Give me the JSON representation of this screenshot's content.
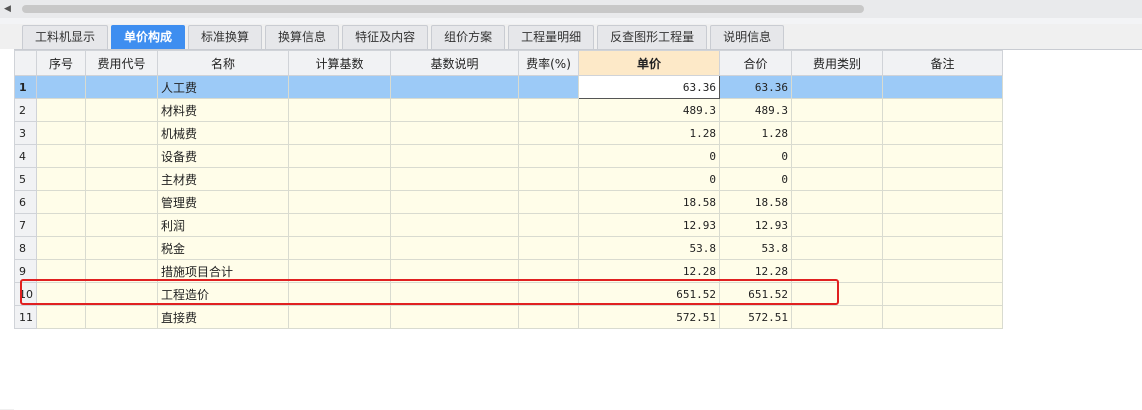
{
  "tabs": [
    "工料机显示",
    "单价构成",
    "标准换算",
    "换算信息",
    "特征及内容",
    "组价方案",
    "工程量明细",
    "反查图形工程量",
    "说明信息"
  ],
  "active_tab": "单价构成",
  "columns": [
    "",
    "序号",
    "费用代号",
    "名称",
    "计算基数",
    "基数说明",
    "费率(%)",
    "单价",
    "合价",
    "费用类别",
    "备注"
  ],
  "rows": [
    {
      "no": "1",
      "seq": "",
      "code": "",
      "name": "人工费",
      "base": "",
      "base_desc": "",
      "rate": "",
      "unit_price": "63.36",
      "total": "63.36",
      "category": "",
      "remark": ""
    },
    {
      "no": "2",
      "seq": "",
      "code": "",
      "name": "材料费",
      "base": "",
      "base_desc": "",
      "rate": "",
      "unit_price": "489.3",
      "total": "489.3",
      "category": "",
      "remark": ""
    },
    {
      "no": "3",
      "seq": "",
      "code": "",
      "name": "机械费",
      "base": "",
      "base_desc": "",
      "rate": "",
      "unit_price": "1.28",
      "total": "1.28",
      "category": "",
      "remark": ""
    },
    {
      "no": "4",
      "seq": "",
      "code": "",
      "name": "设备费",
      "base": "",
      "base_desc": "",
      "rate": "",
      "unit_price": "0",
      "total": "0",
      "category": "",
      "remark": ""
    },
    {
      "no": "5",
      "seq": "",
      "code": "",
      "name": "主材费",
      "base": "",
      "base_desc": "",
      "rate": "",
      "unit_price": "0",
      "total": "0",
      "category": "",
      "remark": ""
    },
    {
      "no": "6",
      "seq": "",
      "code": "",
      "name": "管理费",
      "base": "",
      "base_desc": "",
      "rate": "",
      "unit_price": "18.58",
      "total": "18.58",
      "category": "",
      "remark": ""
    },
    {
      "no": "7",
      "seq": "",
      "code": "",
      "name": "利润",
      "base": "",
      "base_desc": "",
      "rate": "",
      "unit_price": "12.93",
      "total": "12.93",
      "category": "",
      "remark": ""
    },
    {
      "no": "8",
      "seq": "",
      "code": "",
      "name": "税金",
      "base": "",
      "base_desc": "",
      "rate": "",
      "unit_price": "53.8",
      "total": "53.8",
      "category": "",
      "remark": ""
    },
    {
      "no": "9",
      "seq": "",
      "code": "",
      "name": "措施项目合计",
      "base": "",
      "base_desc": "",
      "rate": "",
      "unit_price": "12.28",
      "total": "12.28",
      "category": "",
      "remark": ""
    },
    {
      "no": "10",
      "seq": "",
      "code": "",
      "name": "工程造价",
      "base": "",
      "base_desc": "",
      "rate": "",
      "unit_price": "651.52",
      "total": "651.52",
      "category": "",
      "remark": ""
    },
    {
      "no": "11",
      "seq": "",
      "code": "",
      "name": "直接费",
      "base": "",
      "base_desc": "",
      "rate": "",
      "unit_price": "572.51",
      "total": "572.51",
      "category": "",
      "remark": ""
    }
  ],
  "selected_row": 0,
  "highlighted_row": 9,
  "colors": {
    "active_tab": "#3e8ef0",
    "selected_row": "#9ccaf7",
    "highlight_box": "#e02020",
    "row_bg": "#fffde9"
  }
}
